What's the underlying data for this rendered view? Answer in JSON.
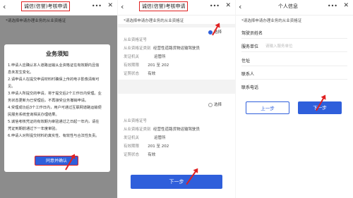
{
  "icons": {
    "back": "chevron-left-icon",
    "more": "more-icon",
    "close": "close-icon"
  },
  "colors": {
    "accent": "#2f5fdb",
    "highlight": "#e02020"
  },
  "panel1": {
    "title": "诚信(信誉)考核申请",
    "back": "‹",
    "more": "•••",
    "close": "✕",
    "note": "*请选择申请办理业务的从业资格证",
    "modal": {
      "title": "业务须知",
      "lines": [
        "1.申请人应确认本人道路运输从业资格证在有效期内且信",
        "息未发生变化。",
        "2.请申请人在提交申请材料时确保上传的电子影像清晰可",
        "见。",
        "3.申请人所提交的申请，将于提交后2个工作日内受理。业",
        "务状态更新为已受理后，不再接受业务撤销申请。",
        "4.受理成功后3个工作日内，用户可通过互联网道路运输便",
        "民服务系统查询相关办理结果。",
        "5.诚信考核凭证的有效期为审验通过之日起一年内，请在",
        "凭证到期前通过下一年度审验。",
        "6.申请人对所提交材料的真实性、有效性与合法性负责。"
      ],
      "agree_label": "同意并确认"
    }
  },
  "panel2": {
    "title": "诚信(信誉)考核申请",
    "back": "‹",
    "more": "•••",
    "close": "✕",
    "note": "*请选择申请办理业务的从业资格证",
    "select_label": "选择",
    "card1": {
      "rows": [
        {
          "k": "从业资格证号",
          "v": ""
        },
        {
          "k": "从业资格证类别",
          "v": "经营性道路货物运输驾驶员"
        },
        {
          "k": "发证机关",
          "v": "运管所"
        },
        {
          "k": "有效期限",
          "v": "201      至 202"
        },
        {
          "k": "证照状态",
          "v": "有效"
        }
      ]
    },
    "card2": {
      "rows": [
        {
          "k": "从业资格证号",
          "v": ""
        },
        {
          "k": "从业资格证类别",
          "v": "经营性道路货物运输驾驶员"
        },
        {
          "k": "发证机关",
          "v": "运管所"
        },
        {
          "k": "有效期限",
          "v": "201      至 202"
        },
        {
          "k": "证照状态",
          "v": "有效"
        }
      ]
    },
    "next_label": "下一步"
  },
  "panel3": {
    "title": "个人信息",
    "back": "‹",
    "more": "•••",
    "close": "✕",
    "note": "*请选择申请办理业务的从业资格证",
    "fields": [
      {
        "label": "驾驶员姓名",
        "placeholder": ""
      },
      {
        "label": "服务单位",
        "placeholder": "请输入服务单位"
      },
      {
        "label": "住址",
        "placeholder": ""
      },
      {
        "label": "联系人",
        "placeholder": ""
      },
      {
        "label": "联系电话",
        "placeholder": ""
      }
    ],
    "prev_label": "上一步",
    "next_label": "下一步"
  }
}
